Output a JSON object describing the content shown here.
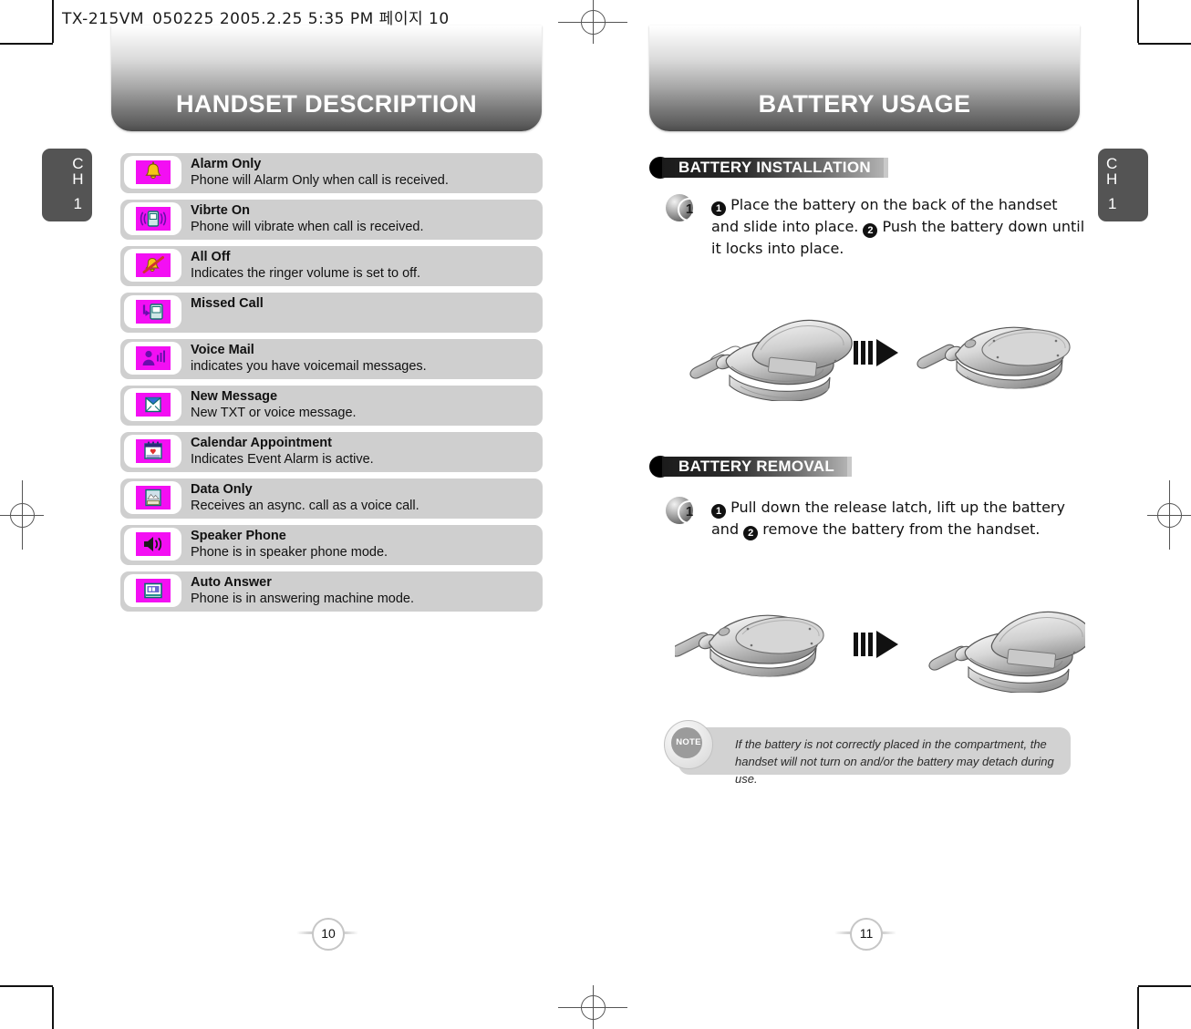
{
  "document": {
    "file_header": "TX-215VM_050225  2005.2.25 5:35 PM 페이지 10"
  },
  "left_page": {
    "chapter_tab": {
      "ch": "CH",
      "number": "1"
    },
    "banner_title": "HANDSET DESCRIPTION",
    "page_number": "10",
    "icon_list": [
      {
        "icon": "bell-icon",
        "title": "Alarm Only",
        "description": "Phone will Alarm Only when call is received."
      },
      {
        "icon": "vibrate-icon",
        "title": "Vibrte On",
        "description": "Phone will vibrate when call is received."
      },
      {
        "icon": "bell-muted-icon",
        "title": "All Off",
        "description": "Indicates the ringer volume is set to off."
      },
      {
        "icon": "missed-call-icon",
        "title": "Missed Call",
        "description": ""
      },
      {
        "icon": "voicemail-icon",
        "title": "Voice Mail",
        "description": "indicates you have voicemail messages."
      },
      {
        "icon": "envelope-icon",
        "title": "New Message",
        "description": "New TXT or voice message."
      },
      {
        "icon": "calendar-icon",
        "title": "Calendar Appointment",
        "description": "Indicates Event Alarm is active."
      },
      {
        "icon": "folder-data-icon",
        "title": "Data Only",
        "description": "Receives an async. call as a voice call."
      },
      {
        "icon": "speaker-icon",
        "title": "Speaker Phone",
        "description": "Phone is in speaker phone mode."
      },
      {
        "icon": "auto-answer-icon",
        "title": "Auto Answer",
        "description": "Phone is in answering machine mode."
      }
    ]
  },
  "right_page": {
    "chapter_tab": {
      "ch": "CH",
      "number": "1"
    },
    "banner_title": "BATTERY USAGE",
    "page_number": "11",
    "sections": [
      {
        "heading": "BATTERY INSTALLATION",
        "step_number": "1",
        "text_parts": [
          {
            "marker": "1",
            "text": " Place the battery on the back of the handset and slide into place. "
          },
          {
            "marker": "2",
            "text": " Push the battery down until it locks into place."
          }
        ],
        "illustration": "flip-phone-open-to-closed-with-battery"
      },
      {
        "heading": "BATTERY REMOVAL",
        "step_number": "1",
        "text_parts": [
          {
            "marker": "1",
            "text": " Pull down the release latch, lift up the battery and "
          },
          {
            "marker": "2",
            "text": " remove the battery from the handset."
          }
        ],
        "illustration": "flip-phone-closed-to-open-battery-removed"
      }
    ],
    "note": {
      "badge_label": "NOTE",
      "text": "If the battery is not correctly placed in the compartment, the handset will not turn on and/or the battery may detach during use."
    }
  },
  "colors": {
    "icon_background": "#f30ff3",
    "row_background": "#cfcfcf",
    "tab_background": "#545454"
  }
}
